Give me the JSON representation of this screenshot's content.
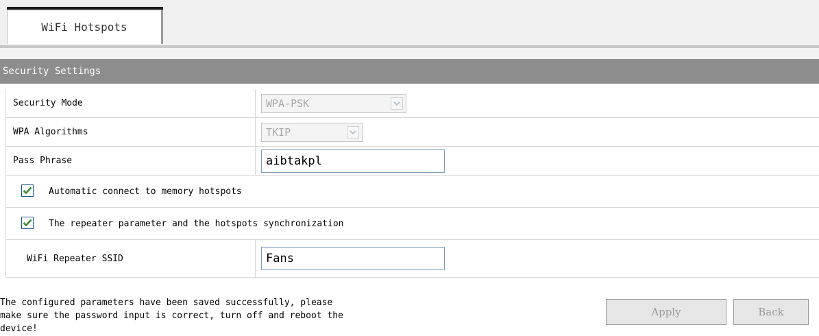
{
  "tabs": [
    {
      "label": "WiFi Hotspots",
      "active": true
    }
  ],
  "section": {
    "title": "Security Settings"
  },
  "form": {
    "security_mode": {
      "label": "Security Mode",
      "value": "WPA-PSK",
      "disabled": true
    },
    "wpa_algorithms": {
      "label": "WPA Algorithms",
      "value": "TKIP",
      "disabled": true
    },
    "pass_phrase": {
      "label": "Pass Phrase",
      "value": "aibtakpl"
    },
    "auto_connect": {
      "label": "Automatic connect to memory hotspots",
      "checked": true
    },
    "repeater_sync": {
      "label": "The repeater parameter and the hotspots synchronization",
      "checked": true
    },
    "repeater_ssid": {
      "label": "WiFi Repeater SSID",
      "value": "Fans"
    }
  },
  "footer": {
    "message": "The configured parameters have been saved successfully, please\nmake sure the password input is correct, turn off and reboot the\ndevice!",
    "apply_label": "Apply",
    "back_label": "Back"
  },
  "colors": {
    "section_header_bg": "#8d8d8d",
    "check_mark": "#2e8b2e",
    "border": "#d6d6d6"
  }
}
